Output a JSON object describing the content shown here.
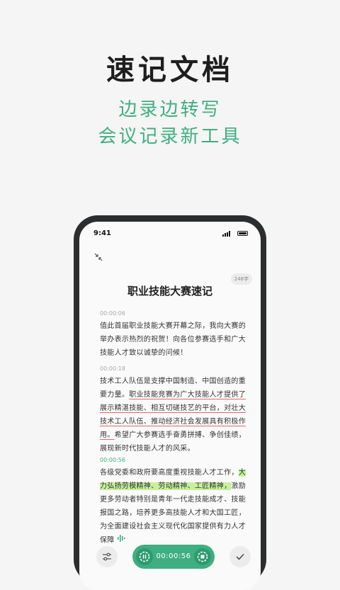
{
  "hero": {
    "title": "速记文档",
    "subtitle_line1": "边录边转写",
    "subtitle_line2": "会议记录新工具"
  },
  "status_bar": {
    "time": "9:41"
  },
  "document": {
    "word_count": "248字",
    "title": "职业技能大赛速记",
    "paragraphs": [
      {
        "timestamp": "00:00:06",
        "segments": [
          {
            "text": "值此首届职业技能大赛开幕之际，我向大赛的举办表示热烈的祝贺！向各位参赛选手和广大技能人才致以诚挚的问候！",
            "style": "normal"
          }
        ]
      },
      {
        "timestamp": "00:00:18",
        "segments": [
          {
            "text": "技术工人队伍是支撑中国制造、中国创造的重要力量。",
            "style": "normal"
          },
          {
            "text": "职业技能竞赛为广大技能人才提供了展示精湛技能、相互切磋技艺的平台，对壮大技术工人队伍、推动经济社会发展具有积极作用。",
            "style": "underline"
          },
          {
            "text": "希望广大参赛选手奋勇拼搏、争创佳绩，展现新时代技能人才的风采。",
            "style": "normal"
          }
        ]
      },
      {
        "timestamp": "00:00:56",
        "segments": [
          {
            "text": "各级党委和政府要高度重视技能人才工作，",
            "style": "normal"
          },
          {
            "text": "大力弘扬劳模精神、劳动精神、工匠精神，",
            "style": "highlight"
          },
          {
            "text": "激励更多劳动者特别是青年一代走技能成才、技能报国之路，培养更多高技能人才和大国工匠，为全面建设社会主义现代化国家提供有力人才保障",
            "style": "normal"
          }
        ]
      }
    ]
  },
  "recorder": {
    "elapsed": "00:00:56"
  },
  "colors": {
    "accent": "#3fae82",
    "highlight": "#c8f09c",
    "underline": "#e06868",
    "phone_frame": "#2b2d2e"
  },
  "icons": {
    "collapse": "collapse-arrows-icon",
    "settings": "sliders-icon",
    "pause": "pause-icon",
    "stop": "stop-icon",
    "done": "check-icon",
    "voice": "voice-wave-icon"
  }
}
